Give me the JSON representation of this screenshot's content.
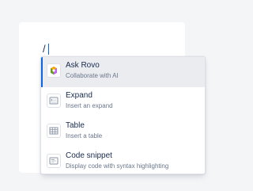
{
  "editor": {
    "typed_text": "/"
  },
  "menu": {
    "items": [
      {
        "title": "Ask Rovo",
        "description": "Collaborate with AI",
        "icon": "rovo-icon"
      },
      {
        "title": "Expand",
        "description": "Insert an expand",
        "icon": "expand-icon"
      },
      {
        "title": "Table",
        "description": "Insert a table",
        "icon": "table-icon"
      },
      {
        "title": "Code snippet",
        "description": "Display code with syntax highlighting",
        "icon": "code-snippet-icon"
      }
    ]
  },
  "colors": {
    "accent": "#0c66e4",
    "selected_bg": "#ebecf0",
    "title_text": "#172b4d",
    "desc_text": "#6b778c"
  }
}
